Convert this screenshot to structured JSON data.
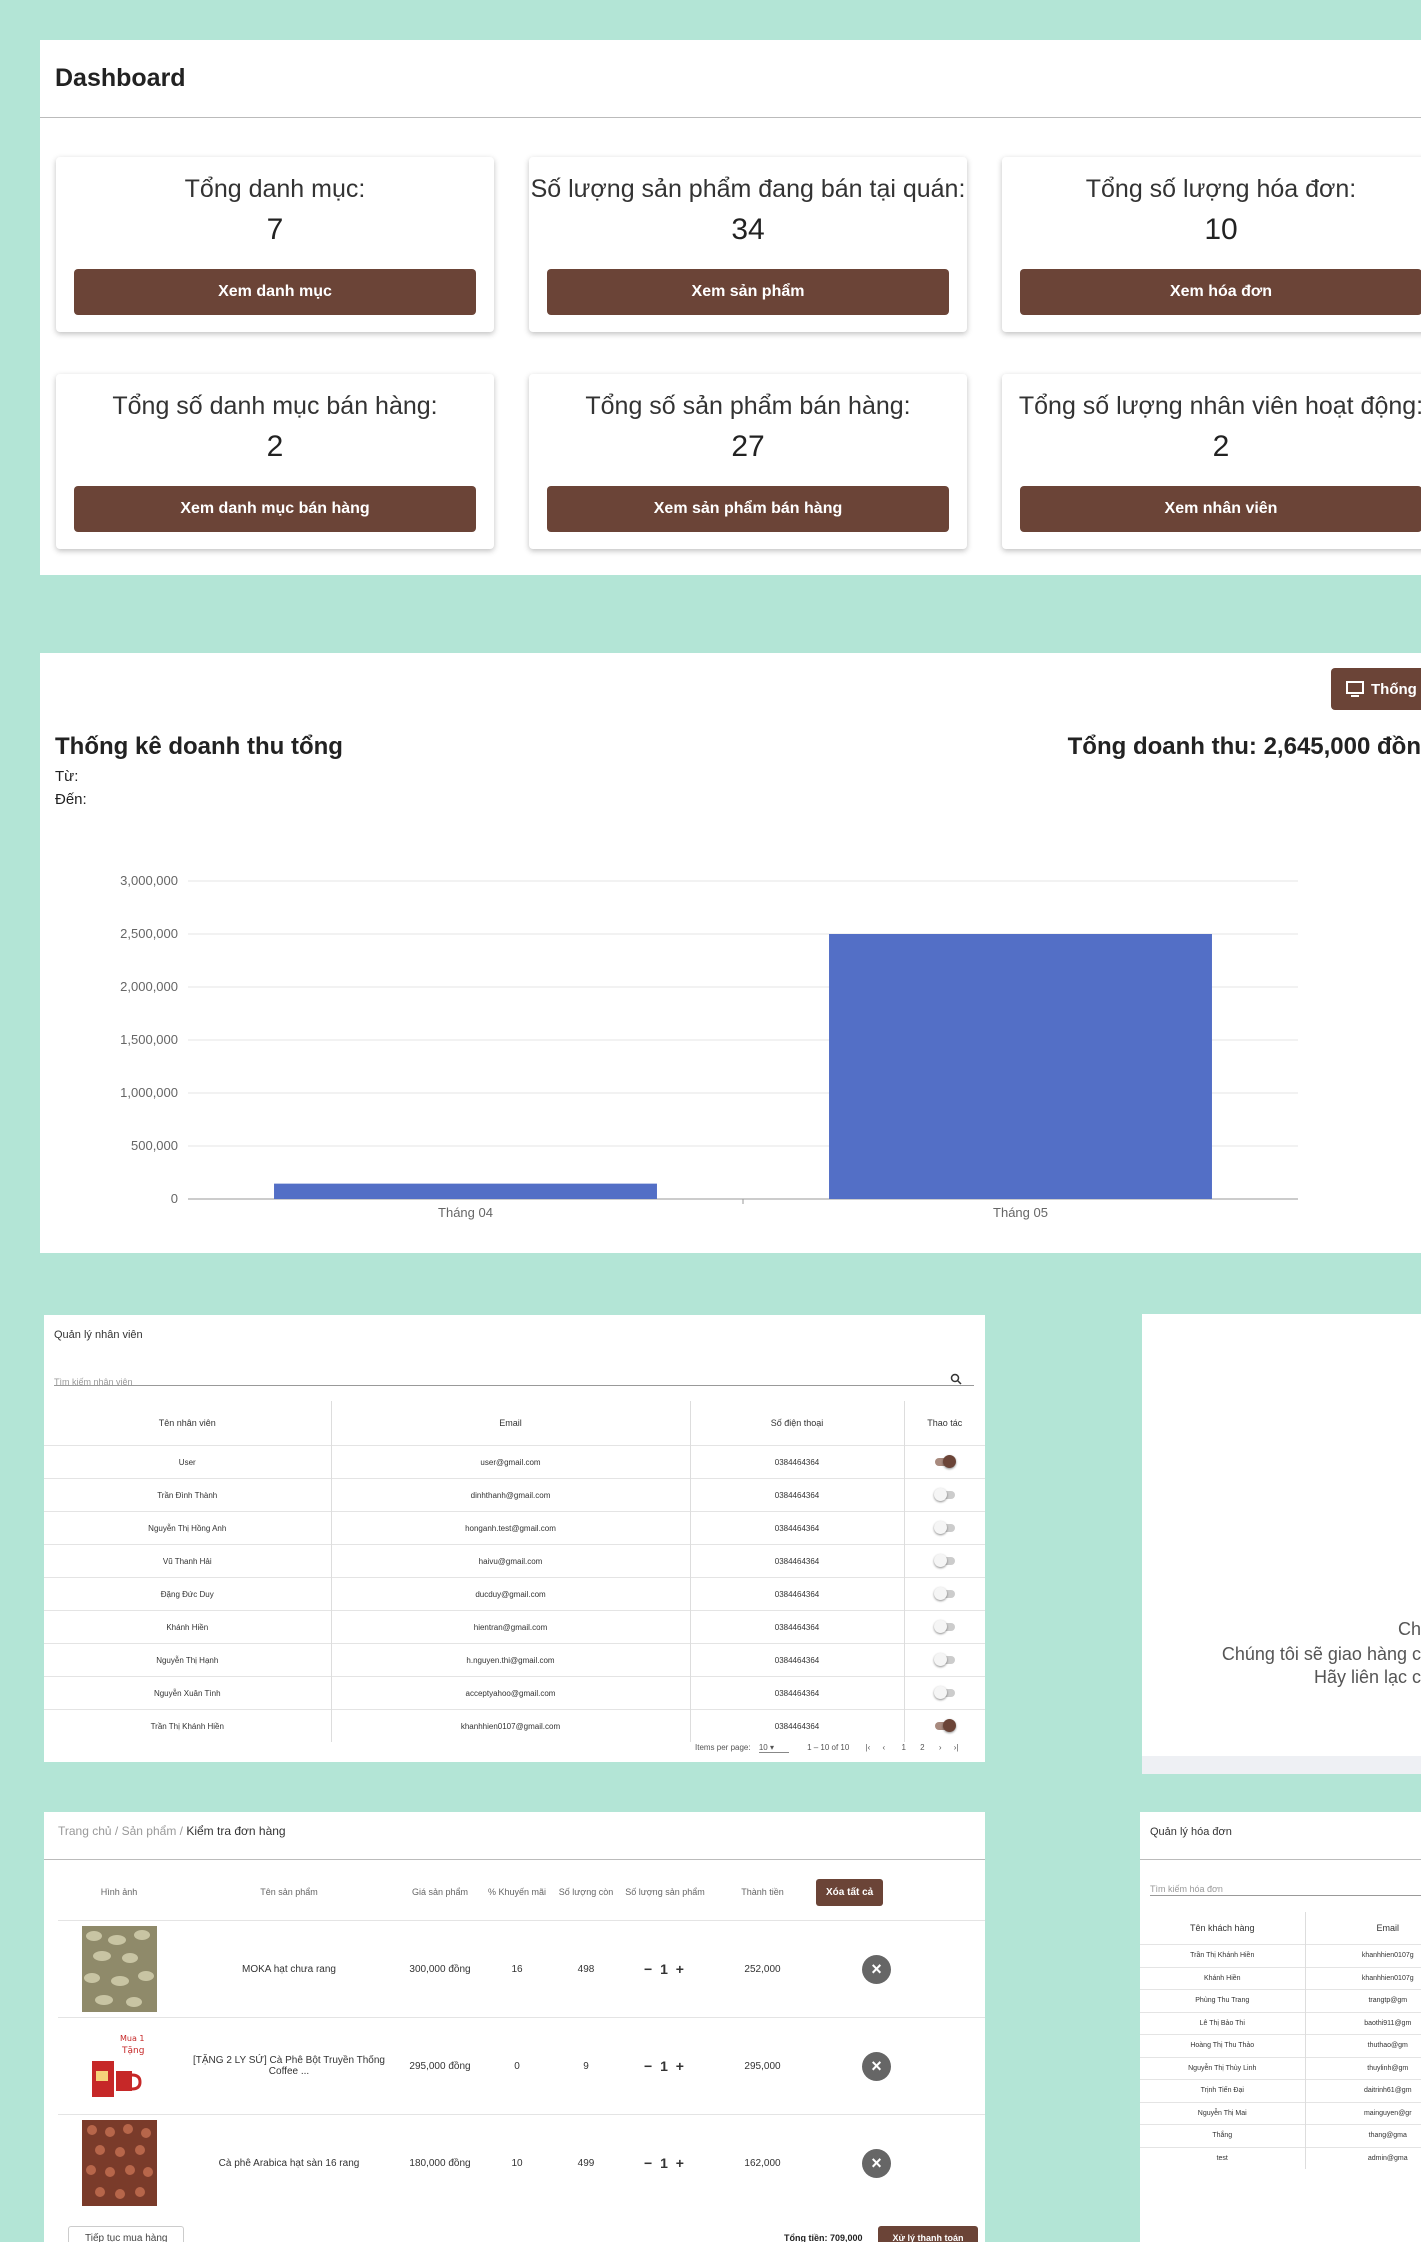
{
  "dashboard": {
    "title": "Dashboard",
    "cards": [
      {
        "label": "Tổng danh mục:",
        "value": "7",
        "button": "Xem danh mục"
      },
      {
        "label": "Số lượng sản phẩm đang bán tại quán:",
        "value": "34",
        "button": "Xem sản phẩm"
      },
      {
        "label": "Tổng số lượng hóa đơn:",
        "value": "10",
        "button": "Xem hóa đơn"
      },
      {
        "label": "Tổng số danh mục bán hàng:",
        "value": "2",
        "button": "Xem danh mục bán hàng"
      },
      {
        "label": "Tổng số sản phẩm bán hàng:",
        "value": "27",
        "button": "Xem sản phẩm bán hàng"
      },
      {
        "label": "Tổng số lượng nhân viên hoạt động:",
        "value": "2",
        "button": "Xem nhân viên"
      }
    ]
  },
  "revenue": {
    "top_button": "Thống",
    "title": "Thống kê doanh thu tổng",
    "total": "Tổng doanh thu: 2,645,000 đồn",
    "from_label": "Từ:",
    "to_label": "Đến:"
  },
  "chart_data": {
    "type": "bar",
    "categories": [
      "Tháng 04",
      "Tháng 05"
    ],
    "values": [
      145000,
      2500000
    ],
    "ylim": [
      0,
      3000000
    ],
    "yticks": [
      0,
      500000,
      1000000,
      1500000,
      2000000,
      2500000,
      3000000
    ],
    "ytick_labels": [
      "0",
      "500,000",
      "1,000,000",
      "1,500,000",
      "2,000,000",
      "2,500,000",
      "3,000,000"
    ],
    "grid": true,
    "color": "#536fc6"
  },
  "staff": {
    "title": "Quản lý nhân viên",
    "search_placeholder": "Tìm kiếm nhân viên",
    "columns": [
      "Tên nhân viên",
      "Email",
      "Số điện thoại",
      "Thao tác"
    ],
    "rows": [
      {
        "name": "User",
        "email": "user@gmail.com",
        "phone": "0384464364",
        "active": true
      },
      {
        "name": "Trần Đình Thành",
        "email": "dinhthanh@gmail.com",
        "phone": "0384464364",
        "active": false
      },
      {
        "name": "Nguyễn Thị Hồng Anh",
        "email": "honganh.test@gmail.com",
        "phone": "0384464364",
        "active": false
      },
      {
        "name": "Vũ Thanh Hải",
        "email": "haivu@gmail.com",
        "phone": "0384464364",
        "active": false
      },
      {
        "name": "Đặng Đức Duy",
        "email": "ducduy@gmail.com",
        "phone": "0384464364",
        "active": false
      },
      {
        "name": "Khánh Hiền",
        "email": "hientran@gmail.com",
        "phone": "0384464364",
        "active": false
      },
      {
        "name": "Nguyễn Thị Hạnh",
        "email": "h.nguyen.thi@gmail.com",
        "phone": "0384464364",
        "active": false
      },
      {
        "name": "Nguyễn Xuân Tình",
        "email": "acceptyahoo@gmail.com",
        "phone": "0384464364",
        "active": false
      },
      {
        "name": "Trần Thị Khánh Hiền",
        "email": "khanhhien0107@gmail.com",
        "phone": "0384464364",
        "active": true
      }
    ],
    "pager": {
      "items_label": "Items per page:",
      "page_size": "10",
      "range": "1 – 10 of 10",
      "pages": [
        "1",
        "2"
      ]
    }
  },
  "mid_panel": {
    "lines": [
      "Ch",
      "Chúng tôi sẽ giao hàng c",
      "Hãy liên lạc c"
    ]
  },
  "cart": {
    "breadcrumb": [
      "Trang chủ",
      "Sản phẩm",
      "Kiểm tra đơn hàng"
    ],
    "columns": [
      "Hình ảnh",
      "Tên sản phẩm",
      "Giá sản phẩm",
      "% Khuyến mãi",
      "Số lượng còn",
      "Số lượng sản phẩm",
      "Thành tiền"
    ],
    "clear_all": "Xóa tất cả",
    "items": [
      {
        "name": "MOKA hạt chưa rang",
        "price": "300,000 đồng",
        "discount": "16",
        "stock": "498",
        "qty": "1",
        "total": "252,000"
      },
      {
        "name": "[TẶNG 2 LY SỨ] Cà Phê Bột Truyền Thống Coffee ...",
        "price": "295,000 đồng",
        "discount": "0",
        "stock": "9",
        "qty": "1",
        "total": "295,000"
      },
      {
        "name": "Cà phê Arabica hạt sàn 16 rang",
        "price": "180,000 đồng",
        "discount": "10",
        "stock": "499",
        "qty": "1",
        "total": "162,000"
      }
    ],
    "continue": "Tiếp tục mua hàng",
    "total": "Tổng tiền: 709,000",
    "checkout": "Xử lý thanh toán"
  },
  "invoices": {
    "title": "Quản lý hóa đơn",
    "search_placeholder": "Tìm kiếm hóa đơn",
    "columns": [
      "Tên khách hàng",
      "Email"
    ],
    "rows": [
      {
        "name": "Trần Thị Khánh Hiền",
        "email": "khanhhien0107g"
      },
      {
        "name": "Khánh Hiền",
        "email": "khanhhien0107g"
      },
      {
        "name": "Phùng Thu Trang",
        "email": "trangtp@gm"
      },
      {
        "name": "Lê Thị Bảo Thi",
        "email": "baothi911@gm"
      },
      {
        "name": "Hoàng Thị Thu Thảo",
        "email": "thuthao@gm"
      },
      {
        "name": "Nguyễn Thị Thùy Linh",
        "email": "thuylinh@gm"
      },
      {
        "name": "Trịnh Tiến Đại",
        "email": "daitrinh61@gm"
      },
      {
        "name": "Nguyễn Thị Mai",
        "email": "mainguyen@gr"
      },
      {
        "name": "Thắng",
        "email": "thang@gma"
      },
      {
        "name": "test",
        "email": "admin@gma"
      }
    ]
  }
}
